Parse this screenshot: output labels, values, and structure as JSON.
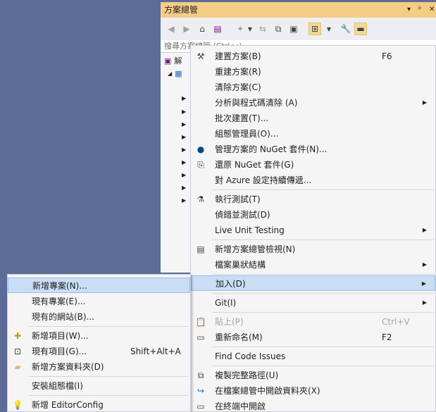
{
  "solution_explorer": {
    "title": "方案總管",
    "title_controls": [
      "▾",
      "ᵖ",
      "✕"
    ],
    "search_placeholder": "搜尋方案總管 (Ctrl+;)",
    "root_label": "解"
  },
  "context_menu": {
    "items": [
      {
        "label": "建置方案(B)",
        "shortcut": "F6",
        "icon": "build-icon"
      },
      {
        "label": "重建方案(R)"
      },
      {
        "label": "清除方案(C)"
      },
      {
        "label": "分析與程式碼清除 (A)",
        "submenu": true
      },
      {
        "label": "批次建置(T)..."
      },
      {
        "label": "組態管理員(O)..."
      },
      {
        "label": "管理方案的 NuGet 套件(N)...",
        "icon": "nuget-icon"
      },
      {
        "label": "還原 NuGet 套件(G)",
        "icon": "restore-icon"
      },
      {
        "label": "對 Azure 設定持續傳遞..."
      },
      {
        "label": "執行測試(T)",
        "icon": "test-flask-icon"
      },
      {
        "label": "偵錯並測試(D)"
      },
      {
        "label": "Live Unit Testing",
        "submenu": true
      },
      {
        "label": "新增方案總管檢視(N)",
        "icon": "new-view-icon"
      },
      {
        "label": "檔案巢狀結構",
        "submenu": true
      },
      {
        "label": "加入(D)",
        "submenu": true
      },
      {
        "label": "Git(I)",
        "submenu": true
      },
      {
        "label": "貼上(P)",
        "shortcut": "Ctrl+V",
        "icon": "paste-icon",
        "disabled": true
      },
      {
        "label": "重新命名(M)",
        "shortcut": "F2",
        "icon": "rename-icon"
      },
      {
        "label": "Find Code Issues"
      },
      {
        "label": "複製完整路徑(U)",
        "icon": "copy-icon"
      },
      {
        "label": "在檔案總管中開啟資料夾(X)",
        "icon": "open-folder-icon"
      },
      {
        "label": "在終端中開啟",
        "icon": "terminal-icon"
      }
    ]
  },
  "add_submenu": {
    "items": [
      {
        "label": "新增專案(N)..."
      },
      {
        "label": "現有專案(E)..."
      },
      {
        "label": "現有的網站(B)..."
      },
      {
        "label": "新增項目(W)...",
        "icon": "new-item-icon"
      },
      {
        "label": "現有項目(G)...",
        "shortcut": "Shift+Alt+A",
        "icon": "existing-item-icon"
      },
      {
        "label": "新增方案資料夾(D)",
        "icon": "solution-folder-icon"
      },
      {
        "label": "安裝組態檔(I)"
      },
      {
        "label": "新增 EditorConfig",
        "icon": "lightbulb-icon"
      }
    ]
  }
}
